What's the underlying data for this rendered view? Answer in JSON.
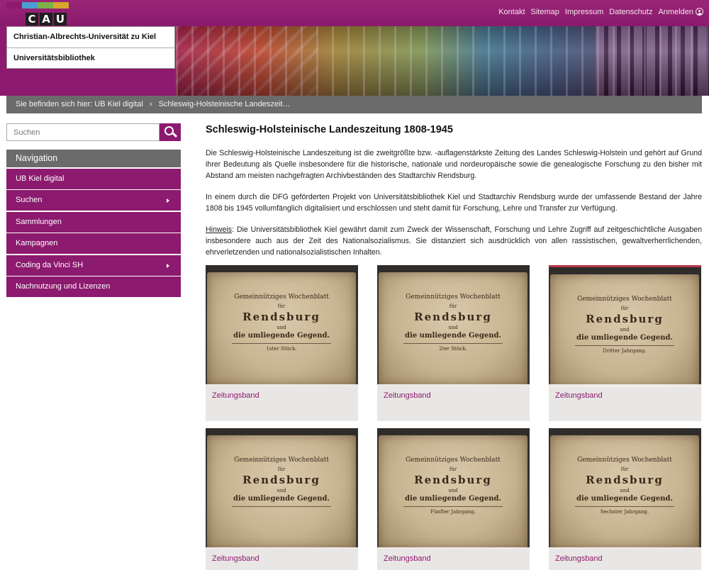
{
  "header": {
    "logo_letters": [
      "C",
      "A",
      "U"
    ],
    "logo_colors": [
      "#8c1a6e",
      "#4a9fd0",
      "#7eb04a",
      "#d8a62b"
    ],
    "top_links": [
      "Kontakt",
      "Sitemap",
      "Impressum",
      "Datenschutz",
      "Anmelden"
    ],
    "university": "Christian-Albrechts-Universität zu Kiel",
    "library": "Universitätsbibliothek"
  },
  "breadcrumb": {
    "prefix": "Sie befinden sich hier:",
    "items": [
      "UB Kiel digital",
      "Schleswig-Holsteinische Landeszeit…"
    ]
  },
  "search": {
    "placeholder": "Suchen"
  },
  "navigation": {
    "title": "Navigation",
    "items": [
      {
        "label": "UB Kiel digital",
        "has_submenu": false
      },
      {
        "label": "Suchen",
        "has_submenu": true
      },
      {
        "label": "Sammlungen",
        "has_submenu": false
      },
      {
        "label": "Kampagnen",
        "has_submenu": false
      },
      {
        "label": "Coding da Vinci SH",
        "has_submenu": true
      },
      {
        "label": "Nachnutzung und Lizenzen",
        "has_submenu": false
      }
    ]
  },
  "main": {
    "title": "Schleswig-Holsteinische Landeszeitung 1808-1945",
    "paragraph1": "Die Schleswig-Holsteinische Landeszeitung ist die zweitgrößte bzw. -auflagenstärkste Zeitung des Landes Schleswig-Holstein und gehört auf Grund ihrer Bedeutung als Quelle insbesondere für die historische, nationale und nordeuropäische sowie die genealogische Forschung zu den bisher mit Abstand am meisten nachgefragten Archivbeständen des Stadtarchiv Rendsburg.",
    "paragraph2": "In einem durch die DFG geförderten Projekt von Universitätsbibliothek Kiel und Stadtarchiv Rendsburg wurde der umfassende Bestand der Jahre 1808 bis 1945 vollumfänglich digitalisiert und erschlossen und steht damit für Forschung, Lehre und Transfer zur Verfügung.",
    "hint_label": "Hinweis",
    "paragraph3": ": Die Universitätsbibliothek Kiel gewährt damit zum Zweck der Wissenschaft, Forschung und Lehre Zugriff auf zeitgeschichtliche Ausgaben insbesondere auch aus der Zeit des Nationalsozialismus. Sie distanziert sich ausdrücklich von allen rassistischen, gewaltverherrlichenden, ehrverletzenden und nationalsozialistischen Inhalten."
  },
  "thumbnails": [
    {
      "caption": "Zeitungsband",
      "lines": [
        "Gemeinnütziges Wochenblatt",
        "für",
        "Rendsburg",
        "und",
        "die umliegende Gegend.",
        "1ster Stück."
      ]
    },
    {
      "caption": "Zeitungsband",
      "lines": [
        "Gemeinnütziges Wochenblatt",
        "für",
        "Rendsburg",
        "und",
        "die umliegende Gegend.",
        "2ter Stück."
      ]
    },
    {
      "caption": "Zeitungsband",
      "lines": [
        "Gemeinnütziges Wochenblatt",
        "für",
        "Rendsburg",
        "und",
        "die umliegende Gegend.",
        "Dritter Jahrgang."
      ]
    },
    {
      "caption": "Zeitungsband",
      "lines": [
        "Gemeinnütziges Wochenblatt",
        "für",
        "Rendsburg",
        "und",
        "die umliegende Gegend.",
        ""
      ]
    },
    {
      "caption": "Zeitungsband",
      "lines": [
        "Gemeinnütziges Wochenblatt",
        "für",
        "Rendsburg",
        "und",
        "die umliegende Gegend.",
        "Fünfter Jahrgang."
      ]
    },
    {
      "caption": "Zeitungsband",
      "lines": [
        "Gemeinnütziges Wochenblatt",
        "für",
        "Rendsburg",
        "und",
        "die umliegende Gegend.",
        "Sechster Jahrgang."
      ]
    }
  ]
}
